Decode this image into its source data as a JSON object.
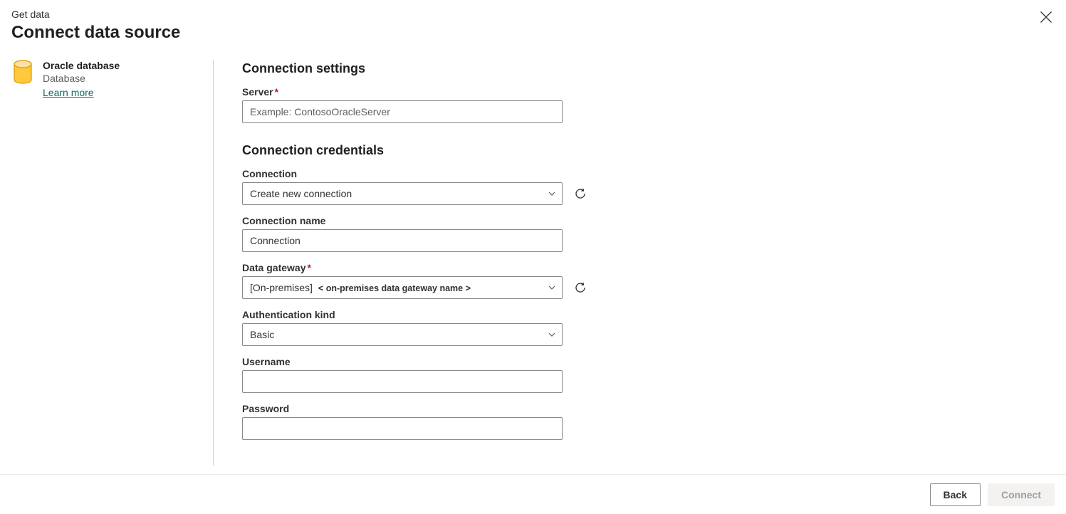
{
  "header": {
    "breadcrumb": "Get data",
    "title": "Connect data source"
  },
  "sidebar": {
    "source_name": "Oracle database",
    "source_type": "Database",
    "learn_more": "Learn more"
  },
  "form": {
    "section_settings": "Connection settings",
    "server": {
      "label": "Server",
      "placeholder": "Example: ContosoOracleServer",
      "value": ""
    },
    "section_credentials": "Connection credentials",
    "connection": {
      "label": "Connection",
      "value": "Create new connection"
    },
    "connection_name": {
      "label": "Connection name",
      "value": "Connection"
    },
    "data_gateway": {
      "label": "Data gateway",
      "prefix": "[On-premises]",
      "suffix": "< on-premises data gateway name >"
    },
    "auth_kind": {
      "label": "Authentication kind",
      "value": "Basic"
    },
    "username": {
      "label": "Username",
      "value": ""
    },
    "password": {
      "label": "Password",
      "value": ""
    }
  },
  "footer": {
    "back": "Back",
    "connect": "Connect"
  }
}
